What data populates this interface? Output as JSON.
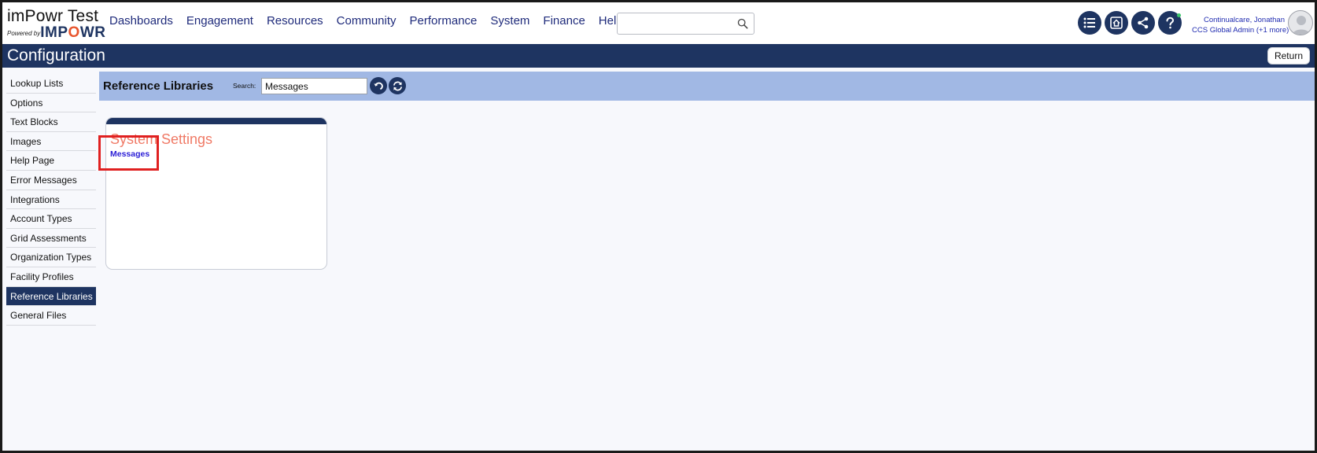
{
  "brand": {
    "title": "imPowr Test",
    "powered_by": "Powered by",
    "logo_left": "IMP",
    "logo_o": "O",
    "logo_right": "WR"
  },
  "nav": {
    "items": [
      "Dashboards",
      "Engagement",
      "Resources",
      "Community",
      "Performance",
      "System",
      "Finance",
      "Help"
    ]
  },
  "top_search": {
    "value": "",
    "placeholder": ""
  },
  "tool_icons": [
    "list-icon",
    "home-icon",
    "share-icon",
    "help-icon"
  ],
  "user": {
    "name": "Continualcare, Jonathan",
    "role": "CCS Global Admin (+1 more)"
  },
  "header": {
    "title": "Configuration",
    "return_label": "Return"
  },
  "sidebar": {
    "items": [
      {
        "label": "Lookup Lists"
      },
      {
        "label": "Options"
      },
      {
        "label": "Text Blocks"
      },
      {
        "label": "Images"
      },
      {
        "label": "Help Page"
      },
      {
        "label": "Error Messages"
      },
      {
        "label": "Integrations"
      },
      {
        "label": "Account Types"
      },
      {
        "label": "Grid Assessments"
      },
      {
        "label": "Organization Types"
      },
      {
        "label": "Facility Profiles"
      },
      {
        "label": "Reference Libraries",
        "active": true
      },
      {
        "label": "General Files"
      }
    ]
  },
  "content": {
    "title": "Reference Libraries",
    "search_label": "Search:",
    "search_value": "Messages",
    "card": {
      "heading": "System Settings",
      "link": "Messages"
    }
  },
  "colors": {
    "navy": "#1e3461",
    "band": "#a1b8e4",
    "heading": "#f07a66",
    "link": "#2a1dd6",
    "highlight": "#e02020"
  }
}
